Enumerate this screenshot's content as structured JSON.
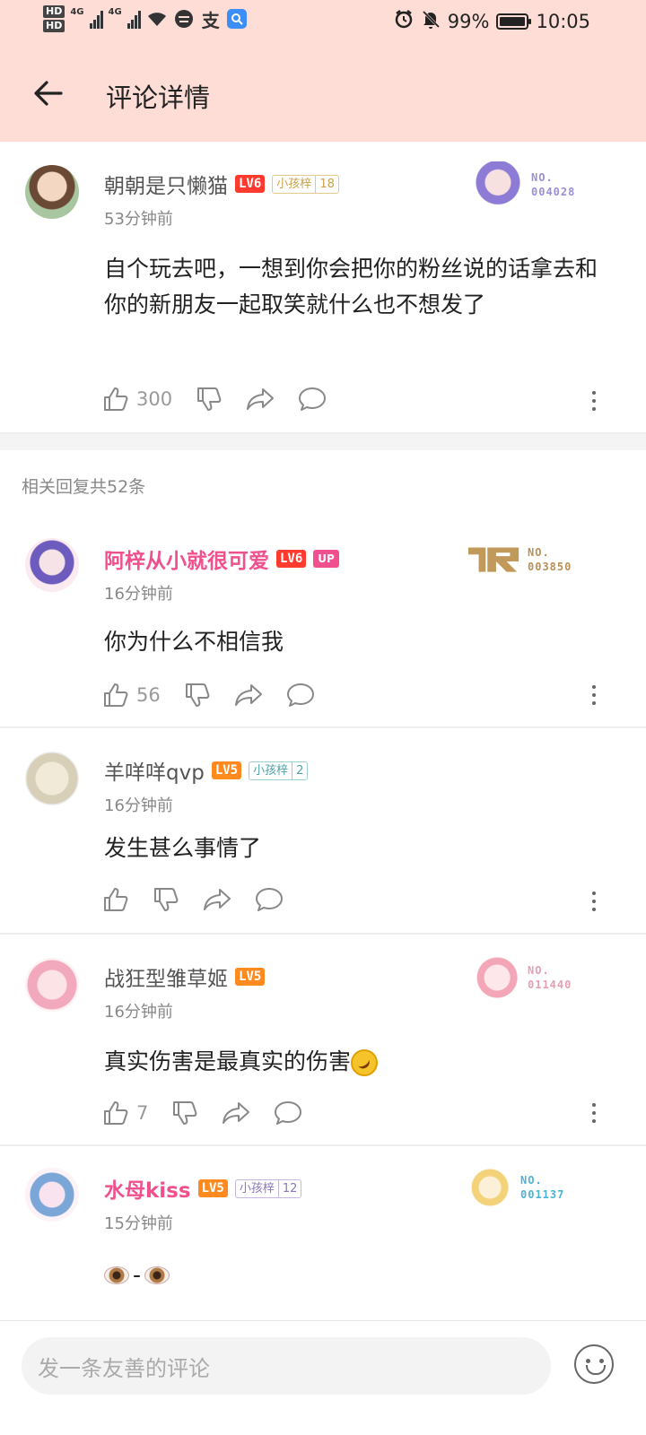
{
  "status_bar": {
    "hd1": "HD",
    "hd2": "HD",
    "net1": "4G",
    "net2": "4G",
    "alipay": "支",
    "battery_pct": "99%",
    "battery_level": 0.99,
    "time": "10:05"
  },
  "header": {
    "title": "评论详情"
  },
  "main_comment": {
    "username": "朝朝是只懒猫",
    "level": "LV6",
    "fan_label": "小孩梓",
    "fan_level": "18",
    "time": "53分钟前",
    "text": "自个玩去吧，一想到你会把你的粉丝说的话拿去和你的新朋友一起取笑就什么也不想发了",
    "likes": "300",
    "badge_no_label": "NO.",
    "badge_no": "004028"
  },
  "replies_header": "相关回复共52条",
  "replies": [
    {
      "username": "阿梓从小就很可爱",
      "level": "LV6",
      "up": "UP",
      "time": "16分钟前",
      "text": "你为什么不相信我",
      "likes": "56",
      "badge_no_label": "NO.",
      "badge_no": "003850"
    },
    {
      "username": "羊咩咩qvp",
      "level": "LV5",
      "fan_label": "小孩梓",
      "fan_level": "2",
      "time": "16分钟前",
      "text": "发生甚么事情了",
      "likes": ""
    },
    {
      "username": "战狂型雏草姬",
      "level": "LV5",
      "time": "16分钟前",
      "text": "真实伤害是最真实的伤害",
      "likes": "7",
      "badge_no_label": "NO.",
      "badge_no": "011440"
    },
    {
      "username": "水母kiss",
      "level": "LV5",
      "fan_label": "小孩梓",
      "fan_level": "12",
      "time": "15分钟前",
      "eye_separator": "-",
      "badge_no_label": "NO.",
      "badge_no": "001137"
    }
  ],
  "bottom_bar": {
    "placeholder": "发一条友善的评论"
  },
  "colors": {
    "header_bg": "#fdddd6",
    "vip_pink": "#f0508d",
    "lv6": "#ff3b2f",
    "lv5": "#ff8a1f"
  }
}
